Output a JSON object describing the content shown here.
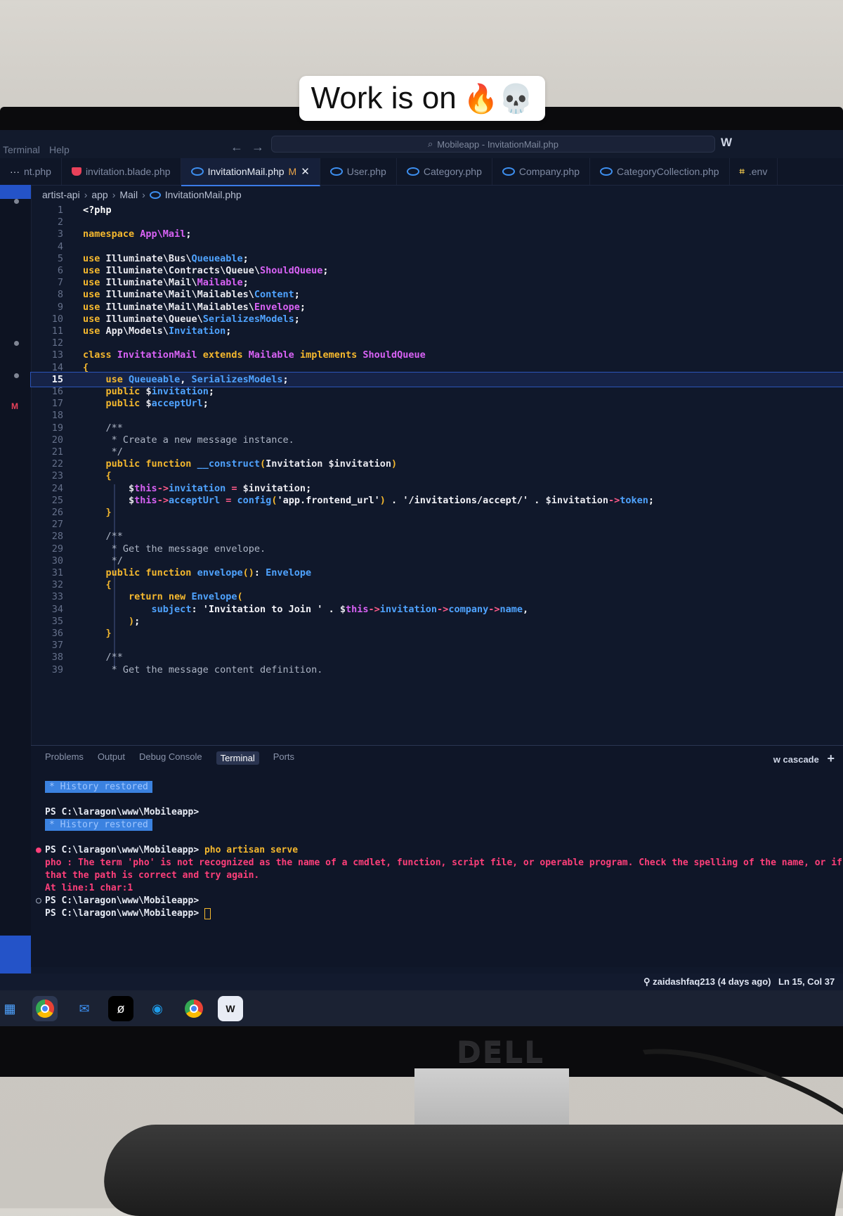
{
  "caption": {
    "text": "Work is on",
    "emoji": "🔥💀"
  },
  "monitor": {
    "brand": "DELL"
  },
  "titlebar": {
    "menu": [
      "Terminal",
      "Help"
    ],
    "search": "Mobileapp - InvitationMail.php",
    "logo": "W"
  },
  "tabs": [
    {
      "label": "nt.php",
      "icon": "none"
    },
    {
      "label": "invitation.blade.php",
      "icon": "blade-icon"
    },
    {
      "label": "InvitationMail.php",
      "icon": "php-icon",
      "modified": "M",
      "active": true
    },
    {
      "label": "User.php",
      "icon": "php-icon"
    },
    {
      "label": "Category.php",
      "icon": "php-icon"
    },
    {
      "label": "Company.php",
      "icon": "php-icon"
    },
    {
      "label": "CategoryCollection.php",
      "icon": "php-icon"
    },
    {
      "label": ".env",
      "icon": "env-icon"
    }
  ],
  "breadcrumb": [
    "artist-api",
    "app",
    "Mail",
    "InvitationMail.php"
  ],
  "editor": {
    "current_line": 15,
    "lines": [
      {
        "n": "1",
        "html": "<span class='pn'>&lt;?php</span>"
      },
      {
        "n": "2",
        "html": ""
      },
      {
        "n": "3",
        "html": "<span class='kw'>namespace</span> <span class='pcls'>App\\Mail</span><span class='pn'>;</span>"
      },
      {
        "n": "4",
        "html": ""
      },
      {
        "n": "5",
        "html": "<span class='kw'>use</span> <span class='ns'>Illuminate\\Bus\\</span><span class='cls'>Queueable</span><span class='pn'>;</span>"
      },
      {
        "n": "6",
        "html": "<span class='kw'>use</span> <span class='ns'>Illuminate\\Contracts\\Queue\\</span><span class='pcls'>ShouldQueue</span><span class='pn'>;</span>"
      },
      {
        "n": "7",
        "html": "<span class='kw'>use</span> <span class='ns'>Illuminate\\Mail\\</span><span class='pcls'>Mailable</span><span class='pn'>;</span>"
      },
      {
        "n": "8",
        "html": "<span class='kw'>use</span> <span class='ns'>Illuminate\\Mail\\Mailables\\</span><span class='cls'>Content</span><span class='pn'>;</span>"
      },
      {
        "n": "9",
        "html": "<span class='kw'>use</span> <span class='ns'>Illuminate\\Mail\\Mailables\\</span><span class='pcls'>Envelope</span><span class='pn'>;</span>"
      },
      {
        "n": "10",
        "html": "<span class='kw'>use</span> <span class='ns'>Illuminate\\Queue\\</span><span class='cls'>SerializesModels</span><span class='pn'>;</span>"
      },
      {
        "n": "11",
        "html": "<span class='kw'>use</span> <span class='ns'>App\\Models\\</span><span class='cls'>Invitation</span><span class='pn'>;</span>"
      },
      {
        "n": "12",
        "html": ""
      },
      {
        "n": "13",
        "html": "<span class='kw'>class</span> <span class='pcls'>InvitationMail</span> <span class='kw'>extends</span> <span class='pcls'>Mailable</span> <span class='kw'>implements</span> <span class='pcls'>ShouldQueue</span>"
      },
      {
        "n": "14",
        "html": "<span class='brace'>{</span>"
      },
      {
        "n": "15",
        "html": "    <span class='kw'>use</span> <span class='cls'>Queueable</span><span class='pn'>,</span> <span class='cls'>SerializesModels</span><span class='pn'>;</span>"
      },
      {
        "n": "16",
        "html": "    <span class='kw'>public</span> <span class='var'>$</span><span class='prop'>invitation</span><span class='pn'>;</span>"
      },
      {
        "n": "17",
        "html": "    <span class='kw'>public</span> <span class='var'>$</span><span class='prop'>acceptUrl</span><span class='pn'>;</span>"
      },
      {
        "n": "18",
        "html": ""
      },
      {
        "n": "19",
        "html": "    <span class='cm'>/**</span>"
      },
      {
        "n": "20",
        "html": "<span class='cm'>     * Create a new message instance.</span>"
      },
      {
        "n": "21",
        "html": "<span class='cm'>     */</span>"
      },
      {
        "n": "22",
        "html": "    <span class='kw'>public function</span> <span class='fn'>__construct</span><span class='brace'>(</span><span class='ns'>Invitation</span> <span class='var'>$invitation</span><span class='brace'>)</span>"
      },
      {
        "n": "23",
        "html": "    <span class='brace'>{</span>"
      },
      {
        "n": "24",
        "html": "        <span class='var'>$</span><span class='pcls'>this</span><span class='op'>-&gt;</span><span class='prop'>invitation</span> <span class='op'>=</span> <span class='var'>$invitation</span><span class='pn'>;</span>"
      },
      {
        "n": "25",
        "html": "        <span class='var'>$</span><span class='pcls'>this</span><span class='op'>-&gt;</span><span class='prop'>acceptUrl</span> <span class='op'>=</span> <span class='fn'>config</span><span class='brace'>(</span><span class='str'>'app.frontend_url'</span><span class='brace'>)</span> <span class='pn'>.</span> <span class='str'>'/invitations/accept/'</span> <span class='pn'>.</span> <span class='var'>$invitation</span><span class='op'>-&gt;</span><span class='prop'>token</span><span class='pn'>;</span>"
      },
      {
        "n": "26",
        "html": "    <span class='brace'>}</span>"
      },
      {
        "n": "27",
        "html": ""
      },
      {
        "n": "28",
        "html": "    <span class='cm'>/**</span>"
      },
      {
        "n": "29",
        "html": "<span class='cm'>     * Get the message envelope.</span>"
      },
      {
        "n": "30",
        "html": "<span class='cm'>     */</span>"
      },
      {
        "n": "31",
        "html": "    <span class='kw'>public function</span> <span class='fn'>envelope</span><span class='brace'>()</span><span class='pn'>:</span> <span class='cls'>Envelope</span>"
      },
      {
        "n": "32",
        "html": "    <span class='brace'>{</span>"
      },
      {
        "n": "33",
        "html": "        <span class='kw'>return new</span> <span class='cls'>Envelope</span><span class='brace'>(</span>"
      },
      {
        "n": "34",
        "html": "            <span class='prop'>subject</span><span class='pn'>:</span> <span class='str'>'Invitation to Join '</span> <span class='pn'>.</span> <span class='var'>$</span><span class='pcls'>this</span><span class='op'>-&gt;</span><span class='prop'>invitation</span><span class='op'>-&gt;</span><span class='prop'>company</span><span class='op'>-&gt;</span><span class='prop'>name</span><span class='pn'>,</span>"
      },
      {
        "n": "35",
        "html": "        <span class='brace'>)</span><span class='pn'>;</span>"
      },
      {
        "n": "36",
        "html": "    <span class='brace'>}</span>"
      },
      {
        "n": "37",
        "html": ""
      },
      {
        "n": "38",
        "html": "    <span class='cm'>/**</span>"
      },
      {
        "n": "39",
        "html": "<span class='cm'>     * Get the message content definition.</span>"
      }
    ]
  },
  "panel": {
    "tabs": [
      "Problems",
      "Output",
      "Debug Console",
      "Terminal",
      "Ports"
    ],
    "active_tab": "Terminal",
    "right_label": "cascade",
    "add_label": "+"
  },
  "terminal": {
    "history1": "History restored",
    "prompt1": "PS C:\\laragon\\www\\Mobileapp>",
    "history2": "History restored",
    "prompt2": "PS C:\\laragon\\www\\Mobileapp>",
    "command": "pho artisan serve",
    "error1": "pho : The term 'pho' is not recognized as the name of a cmdlet, function, script file, or operable program. Check the spelling of the name, or if a path",
    "error2": "that the path is correct and try again.",
    "error3": "At line:1 char:1",
    "prompt3": "PS C:\\laragon\\www\\Mobileapp>",
    "prompt4": "PS C:\\laragon\\www\\Mobileapp>"
  },
  "status": {
    "git": "zaidashfaq213 (4 days ago)",
    "position": "Ln 15, Col 37"
  },
  "taskbar": [
    "start-icon",
    "chrome-icon",
    "mail-icon",
    "app-icon",
    "edge-icon",
    "chrome-icon",
    "windsurf-icon"
  ]
}
